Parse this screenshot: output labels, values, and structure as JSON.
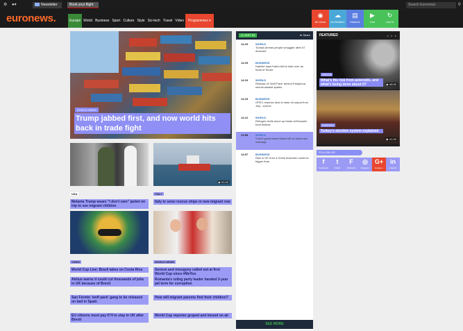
{
  "topbar": {
    "newsletter": "Newsletter",
    "book_flight": "Book your flight",
    "search_placeholder": "Search Euronews"
  },
  "header": {
    "logo": "euronews.",
    "nav": [
      "Europe",
      "World",
      "Business",
      "Sport",
      "Culture",
      "Style",
      "Sci-tech",
      "Travel",
      "Video",
      "Programmes ▾"
    ],
    "tools": [
      {
        "label": "All views",
        "color": "#e8462e",
        "icon": "eye-icon",
        "glyph": "◉"
      },
      {
        "label": "All Weather",
        "color": "#4aa8d8",
        "icon": "cloud-icon",
        "glyph": "☁"
      },
      {
        "label": "Markets",
        "color": "#5a7ee0",
        "icon": "markets-icon",
        "glyph": "▤"
      },
      {
        "label": "Live",
        "color": "#49c25a",
        "icon": "live-icon",
        "glyph": "▶"
      },
      {
        "label": "Just In",
        "color": "#49c25a",
        "icon": "refresh-icon",
        "glyph": "↻"
      }
    ]
  },
  "hero": {
    "tag": "WORLD NEWS",
    "title": "Trump jabbed first, and now world hits back in trade fight"
  },
  "cards": [
    {
      "tag": "USA",
      "title": "Melania Trump wears \"I don't care\" jacket on trip to see migrant children"
    },
    {
      "tag": "ITALY",
      "title": "Italy to seize rescue ships in new migrant row",
      "video": "01:20"
    },
    {
      "tag": "VIDEO",
      "title": "World Cup Live: Brazil takes on Costa Rica"
    },
    {
      "tag": "WORLD NEWS",
      "title": "Sexism and misogyny called out at first World Cup since #MeToo"
    }
  ],
  "text_links": [
    "Airbus warns it could cut thousands of jobs in UK because of Brexit",
    "Romania's ruling party leader handed 3-year jail term for corruption",
    "San Fermin 'wolf pack' gang to be released on bail in Spain",
    "How will migrant parents find their children?",
    "EU citizens must pay €74 to stay in UK after Brexit",
    "World Cup reporter groped and kissed on air"
  ],
  "just_in": {
    "badge": "JUST IN",
    "share": "Share",
    "see_more": "SEE MORE",
    "items": [
      {
        "time": "14:29",
        "category": "WORLD",
        "text": "Tunisia arrests people smuggler after 67 drowned"
      },
      {
        "time": "14:25",
        "category": "BUSINESS",
        "text": "Daimler says Katrin Adt to take over as head of Smart"
      },
      {
        "time": "14:19",
        "category": "WORLD",
        "text": "Release of 'Wolf Pack' behind Pamplona sexual assault sparks"
      },
      {
        "time": "14:15",
        "category": "BUSINESS",
        "text": "OPEC reaches deal to raise oil output from July - source"
      },
      {
        "time": "14:12",
        "category": "WORLD",
        "text": "Refugee chefs serve up treats at Brussels food festival"
      },
      {
        "time": "13:58",
        "category": "WORLD",
        "text": "Czech government backs bill on same-sex marriage",
        "highlight": true
      },
      {
        "time": "13:57",
        "category": "BUSINESS",
        "text": "Risk to UK from a China downturn could be bigger than"
      }
    ]
  },
  "featured": {
    "heading": "FEATURED",
    "items": [
      {
        "tag": "SPACE",
        "title": "What's the risk from asteroids, and what's being done about it?",
        "video": "08:30"
      },
      {
        "tag": "EUROPE",
        "title": "Turkey's election system explained",
        "video": "01:30"
      }
    ]
  },
  "follow_us": "FOLLOW US",
  "social": [
    {
      "label": "Facebook",
      "glyph": "f",
      "icon": "facebook-icon"
    },
    {
      "label": "Twitter",
      "glyph": "t",
      "icon": "twitter-icon"
    },
    {
      "label": "Flipboard",
      "glyph": "F",
      "icon": "flipboard-icon"
    },
    {
      "label": "Instagram",
      "glyph": "◎",
      "icon": "instagram-icon"
    },
    {
      "label": "Google +",
      "glyph": "G+",
      "icon": "google-plus-icon"
    },
    {
      "label": "LinkedIn",
      "glyph": "in",
      "icon": "linkedin-icon"
    }
  ]
}
